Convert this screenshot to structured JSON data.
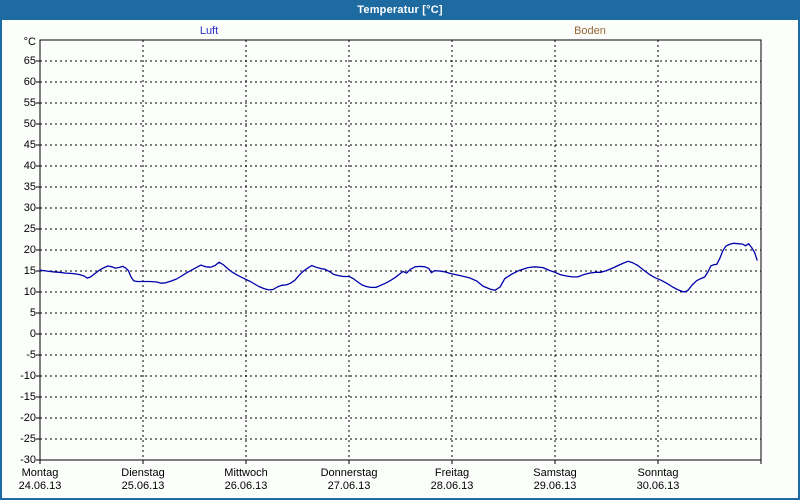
{
  "window": {
    "title": "Temperatur [°C]",
    "titlebar_color": "#1d6ba0",
    "border_color": "#1d6ba0",
    "background_color": "#fcfefc"
  },
  "legend": {
    "luft": {
      "label": "Luft",
      "color": "#2a2ac8"
    },
    "boden": {
      "label": "Boden",
      "color": "#996633"
    }
  },
  "chart_data": {
    "type": "line",
    "title": "Temperatur [°C]",
    "ylabel": "°C",
    "ylim": [
      -30,
      70
    ],
    "y_tick_step": 5,
    "y_ticks": [
      65,
      60,
      55,
      50,
      45,
      40,
      35,
      30,
      25,
      20,
      15,
      10,
      5,
      0,
      -5,
      -10,
      -15,
      -20,
      -25,
      -30
    ],
    "grid": "dashed",
    "legend_position": "top",
    "x_axis": {
      "total_hours": 168,
      "days": [
        {
          "name": "Montag",
          "date": "24.06.13"
        },
        {
          "name": "Dienstag",
          "date": "25.06.13"
        },
        {
          "name": "Mittwoch",
          "date": "26.06.13"
        },
        {
          "name": "Donnerstag",
          "date": "27.06.13"
        },
        {
          "name": "Freitag",
          "date": "28.06.13"
        },
        {
          "name": "Samstag",
          "date": "29.06.13"
        },
        {
          "name": "Sonntag",
          "date": "30.06.13"
        }
      ]
    },
    "series": [
      {
        "name": "Luft",
        "color": "#0000aa",
        "points": [
          [
            0,
            15.2
          ],
          [
            1.5,
            15
          ],
          [
            3,
            14.8
          ],
          [
            4.5,
            14.7
          ],
          [
            6,
            14.5
          ],
          [
            7.5,
            14.4
          ],
          [
            9,
            14.2
          ],
          [
            10.3,
            13.8
          ],
          [
            11,
            13.3
          ],
          [
            11.8,
            13.6
          ],
          [
            12.7,
            14.3
          ],
          [
            13.7,
            15.1
          ],
          [
            14.7,
            15.7
          ],
          [
            15.8,
            16.2
          ],
          [
            16.8,
            16
          ],
          [
            17.5,
            15.7
          ],
          [
            18.3,
            15.8
          ],
          [
            19.3,
            16.1
          ],
          [
            20,
            15.7
          ],
          [
            20.6,
            15.1
          ],
          [
            21.2,
            13.6
          ],
          [
            21.8,
            12.7
          ],
          [
            22.6,
            12.5
          ],
          [
            24,
            12.5
          ],
          [
            25.5,
            12.5
          ],
          [
            27,
            12.4
          ],
          [
            28.3,
            12.1
          ],
          [
            29.3,
            12.2
          ],
          [
            30.5,
            12.6
          ],
          [
            31.8,
            13.1
          ],
          [
            33,
            13.8
          ],
          [
            34.2,
            14.6
          ],
          [
            35.3,
            15.2
          ],
          [
            36.4,
            15.8
          ],
          [
            37.5,
            16.4
          ],
          [
            38.6,
            16
          ],
          [
            39.8,
            15.9
          ],
          [
            40.8,
            16.3
          ],
          [
            41.7,
            17.1
          ],
          [
            42.7,
            16.5
          ],
          [
            43.7,
            15.6
          ],
          [
            44.7,
            14.8
          ],
          [
            45.7,
            14.2
          ],
          [
            46.8,
            13.6
          ],
          [
            48,
            13
          ],
          [
            49,
            12.5
          ],
          [
            50,
            11.9
          ],
          [
            51,
            11.3
          ],
          [
            52.2,
            10.8
          ],
          [
            53.3,
            10.5
          ],
          [
            54.3,
            10.6
          ],
          [
            55.3,
            11.2
          ],
          [
            56.3,
            11.6
          ],
          [
            57.4,
            11.7
          ],
          [
            58.4,
            12.1
          ],
          [
            59.4,
            12.8
          ],
          [
            60.4,
            14
          ],
          [
            61.4,
            15
          ],
          [
            62.4,
            15.7
          ],
          [
            63.3,
            16.3
          ],
          [
            64.3,
            15.9
          ],
          [
            65.4,
            15.6
          ],
          [
            66.4,
            15.4
          ],
          [
            67.4,
            14.9
          ],
          [
            68.4,
            14.2
          ],
          [
            69.5,
            13.9
          ],
          [
            70.7,
            13.7
          ],
          [
            72,
            13.7
          ],
          [
            73,
            13.2
          ],
          [
            74,
            12.4
          ],
          [
            75,
            11.7
          ],
          [
            76,
            11.3
          ],
          [
            77,
            11.1
          ],
          [
            78.3,
            11.1
          ],
          [
            79.4,
            11.6
          ],
          [
            80.5,
            12.1
          ],
          [
            81.6,
            12.7
          ],
          [
            82.7,
            13.4
          ],
          [
            83.7,
            14.2
          ],
          [
            84.6,
            14.9
          ],
          [
            85.4,
            14.5
          ],
          [
            86.3,
            15.4
          ],
          [
            87.4,
            16
          ],
          [
            88.6,
            16.1
          ],
          [
            89.7,
            16
          ],
          [
            90.6,
            15.6
          ],
          [
            91.2,
            14.6
          ],
          [
            92,
            15.1
          ],
          [
            93,
            15
          ],
          [
            94.3,
            14.8
          ],
          [
            95.3,
            14.5
          ],
          [
            96,
            14.3
          ],
          [
            97.9,
            13.9
          ],
          [
            100,
            13.4
          ],
          [
            101.8,
            12.6
          ],
          [
            103.2,
            11.4
          ],
          [
            104.9,
            10.7
          ],
          [
            106,
            10.4
          ],
          [
            107.2,
            11.2
          ],
          [
            108.3,
            13.2
          ],
          [
            110,
            14.3
          ],
          [
            111.8,
            15.2
          ],
          [
            113.7,
            15.8
          ],
          [
            115.3,
            16
          ],
          [
            117.2,
            15.8
          ],
          [
            118.8,
            15.1
          ],
          [
            120,
            14.7
          ],
          [
            121.3,
            14.1
          ],
          [
            122.7,
            13.8
          ],
          [
            124,
            13.6
          ],
          [
            125.3,
            13.6
          ],
          [
            126.6,
            14.1
          ],
          [
            128,
            14.5
          ],
          [
            129.4,
            14.7
          ],
          [
            130.7,
            14.7
          ],
          [
            132,
            15.1
          ],
          [
            133.4,
            15.7
          ],
          [
            134.7,
            16.3
          ],
          [
            136,
            16.9
          ],
          [
            137,
            17.3
          ],
          [
            138,
            17
          ],
          [
            139.3,
            16.3
          ],
          [
            140.7,
            15.2
          ],
          [
            142,
            14.2
          ],
          [
            143.3,
            13.4
          ],
          [
            144.7,
            12.8
          ],
          [
            146,
            12.1
          ],
          [
            147.4,
            11.2
          ],
          [
            148.7,
            10.5
          ],
          [
            150,
            10
          ],
          [
            150.9,
            10.3
          ],
          [
            152,
            11.7
          ],
          [
            153,
            12.7
          ],
          [
            154,
            13.2
          ],
          [
            154.9,
            13.6
          ],
          [
            155.7,
            14.9
          ],
          [
            156.3,
            16.2
          ],
          [
            157,
            16.5
          ],
          [
            157.7,
            16.6
          ],
          [
            158.4,
            18
          ],
          [
            159.1,
            19.8
          ],
          [
            159.8,
            20.9
          ],
          [
            160.6,
            21.3
          ],
          [
            161.6,
            21.6
          ],
          [
            162.7,
            21.5
          ],
          [
            163.7,
            21.4
          ],
          [
            164.4,
            21
          ],
          [
            165.1,
            21.5
          ],
          [
            165.8,
            20.6
          ],
          [
            166.5,
            19.4
          ],
          [
            167.1,
            17.6
          ]
        ]
      },
      {
        "name": "Boden",
        "color": "#996633",
        "points": []
      }
    ]
  }
}
